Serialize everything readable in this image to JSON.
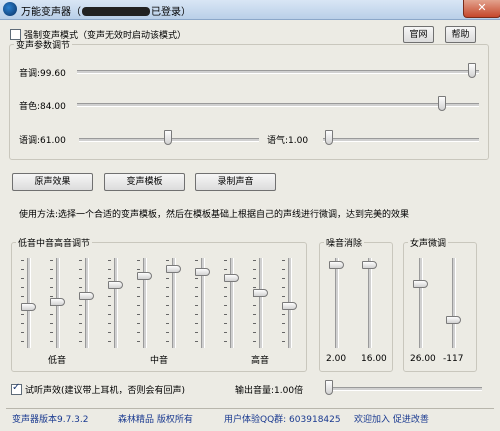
{
  "window": {
    "title_prefix": "万能变声器（",
    "title_suffix": "已登录）",
    "close_label": "✕",
    "icon": "app-icon"
  },
  "options": {
    "force_mode_label": "强制变声模式（变声无效时启动该模式）",
    "force_mode_checked": false,
    "website_button": "官网",
    "help_button": "帮助"
  },
  "params": {
    "group_label": "变声参数调节",
    "pitch": {
      "label": "音调:",
      "value": "99.60"
    },
    "timbre": {
      "label": "音色:",
      "value": "84.00"
    },
    "speed": {
      "label": "语调:",
      "value": "61.00"
    },
    "tone": {
      "label": "语气:",
      "value": "1.00"
    }
  },
  "actions": {
    "original_button": "原声效果",
    "template_button": "变声模板",
    "record_button": "录制声音"
  },
  "usage_text": "使用方法:选择一个合适的变声模板，然后在模板基础上根据自己的声线进行微调，达到完美的效果",
  "eq": {
    "group_label": "低音中音高音调节",
    "low_label": "低音",
    "mid_label": "中音",
    "high_label": "高音"
  },
  "noise": {
    "group_label": "噪音消除",
    "value1": "2.00",
    "value2": "16.00"
  },
  "female": {
    "group_label": "女声微调",
    "value1": "26.00",
    "value2": "-117"
  },
  "monitor": {
    "label": "试听声效(建议带上耳机，否则会有回声)",
    "checked": true
  },
  "output": {
    "label": "输出音量:",
    "value": "1.00倍"
  },
  "status": {
    "version": "变声器版本9.7.3.2",
    "copyright": "森林精品 版权所有",
    "qq_group": "用户体验QQ群: 603918425",
    "join": "欢迎加入 促进改善"
  }
}
